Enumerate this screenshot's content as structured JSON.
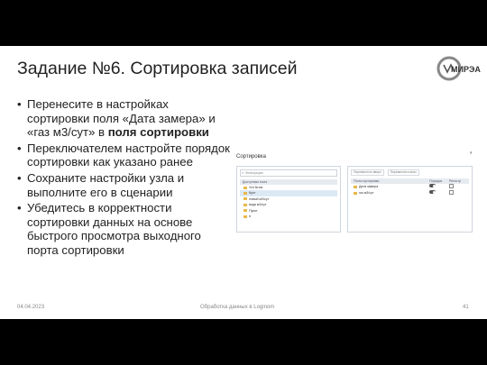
{
  "slide": {
    "title": "Задание №6. Сортировка записей",
    "logo_text": "МИРЭА",
    "bullets": [
      {
        "parts": [
          {
            "text": "Перенесите в настройках сортировки поля «Дата замера» и «газ м3/сут» в ",
            "bold": false
          },
          {
            "text": "поля сортировки",
            "bold": true
          }
        ]
      },
      {
        "parts": [
          {
            "text": "Переключателем настройте порядок сортировки как указано ранее",
            "bold": false
          }
        ]
      },
      {
        "parts": [
          {
            "text": "Сохраните настройки узла и выполните его в сценарии",
            "bold": false
          }
        ]
      },
      {
        "parts": [
          {
            "text": "Убедитесь в корректности сортировки данных на основе быстрого просмотра выходного порта сортировки",
            "bold": false
          }
        ]
      }
    ],
    "footer": {
      "date": "04.04.2023",
      "center": "Обработка данных в Loginom",
      "page": "41"
    }
  },
  "screenshot": {
    "section_label": "Сортировка",
    "corner_mark": "ᵃ",
    "left_panel": {
      "search_placeholder": "Фильтрация",
      "header": "Доступные поля",
      "fields": [
        "Усл.№ны",
        "Куст",
        "новый м3/сут",
        "вода м3/сут",
        "Пункт",
        "#"
      ]
    },
    "right_panel": {
      "toolbar": [
        "Переместить вверх",
        "Переместить вниз"
      ],
      "columns": [
        "Поля сортировки",
        "Порядок",
        "Регистр"
      ],
      "rows": [
        {
          "name": "Дата замера"
        },
        {
          "name": "газ м3/сут"
        }
      ]
    }
  }
}
